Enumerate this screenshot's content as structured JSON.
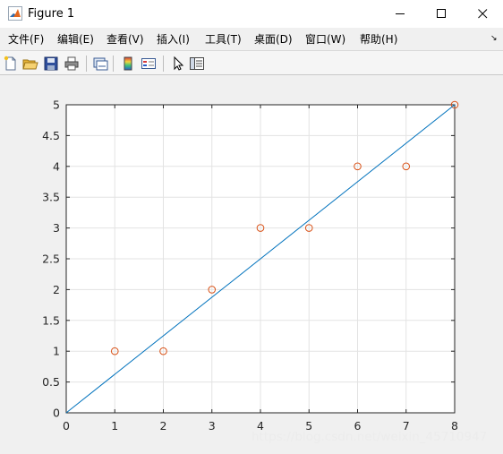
{
  "window": {
    "title": "Figure 1",
    "controls": {
      "minimize": "minimize-icon",
      "maximize": "maximize-icon",
      "close": "close-icon"
    }
  },
  "menu": {
    "items": [
      {
        "label": "文件(F)"
      },
      {
        "label": "编辑(E)"
      },
      {
        "label": "查看(V)"
      },
      {
        "label": "插入(I)"
      },
      {
        "label": "工具(T)"
      },
      {
        "label": "桌面(D)"
      },
      {
        "label": "窗口(W)"
      },
      {
        "label": "帮助(H)"
      }
    ],
    "overflow_arrow": "↘"
  },
  "toolbar": {
    "icons": [
      "new-figure-icon",
      "open-file-icon",
      "save-icon",
      "print-icon",
      "link-figure-icon",
      "insert-colorbar-icon",
      "insert-legend-icon",
      "edit-plot-cursor-icon",
      "property-inspector-icon"
    ]
  },
  "chart_data": {
    "type": "scatter",
    "title": "",
    "xlabel": "",
    "ylabel": "",
    "xlim": [
      0,
      8
    ],
    "ylim": [
      0,
      5
    ],
    "xticks": [
      0,
      1,
      2,
      3,
      4,
      5,
      6,
      7,
      8
    ],
    "yticks": [
      0,
      0.5,
      1,
      1.5,
      2,
      2.5,
      3,
      3.5,
      4,
      4.5,
      5
    ],
    "grid": true,
    "series": [
      {
        "kind": "markers",
        "marker": "circle",
        "color": "#d95319",
        "x": [
          1,
          2,
          3,
          4,
          5,
          6,
          7,
          8
        ],
        "y": [
          1,
          1,
          2,
          3,
          3,
          4,
          4,
          5
        ]
      },
      {
        "kind": "line",
        "color": "#0072bd",
        "x": [
          0,
          8
        ],
        "y": [
          0,
          5
        ]
      }
    ]
  },
  "watermark": "https://blog.csdn.net/weixin_45710947"
}
